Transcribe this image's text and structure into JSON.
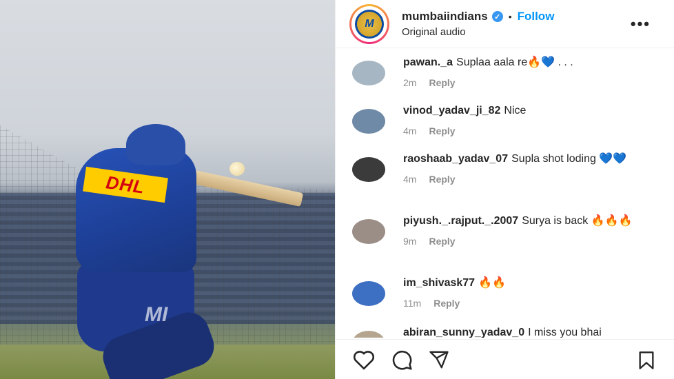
{
  "post": {
    "username": "mumbaiindians",
    "separator": "•",
    "follow_label": "Follow",
    "subtitle": "Original audio",
    "more_label": "•••",
    "avatar_text": "M",
    "watermark": "MI"
  },
  "comments": [
    {
      "user": "pawan._a",
      "text": "Suplaa aala re🔥💙 . . .",
      "time": "2m",
      "reply": "Reply",
      "avatar_color": "#a6b6c3"
    },
    {
      "user": "vinod_yadav_ji_82",
      "text": "Nice",
      "time": "4m",
      "reply": "Reply",
      "avatar_color": "#6f8aa6"
    },
    {
      "user": "raoshaab_yadav_07",
      "text": "Supla shot loding 💙💙",
      "time": "4m",
      "reply": "Reply",
      "avatar_color": "#3b3b3b"
    },
    {
      "user": "piyush._.rajput._.2007",
      "text": "Surya is back 🔥🔥🔥",
      "time": "9m",
      "reply": "Reply",
      "avatar_color": "#9a8e86"
    },
    {
      "user": "im_shivask77",
      "text": "🔥🔥",
      "time": "11m",
      "reply": "Reply",
      "avatar_color": "#3d6fc2"
    },
    {
      "user": "abiran_sunny_yadav_0",
      "text": "I miss you bhai",
      "time": "",
      "reply": "",
      "avatar_color": "#b5a58e"
    }
  ],
  "icons": [
    "heart-icon",
    "comment-icon",
    "share-icon",
    "bookmark-icon"
  ]
}
